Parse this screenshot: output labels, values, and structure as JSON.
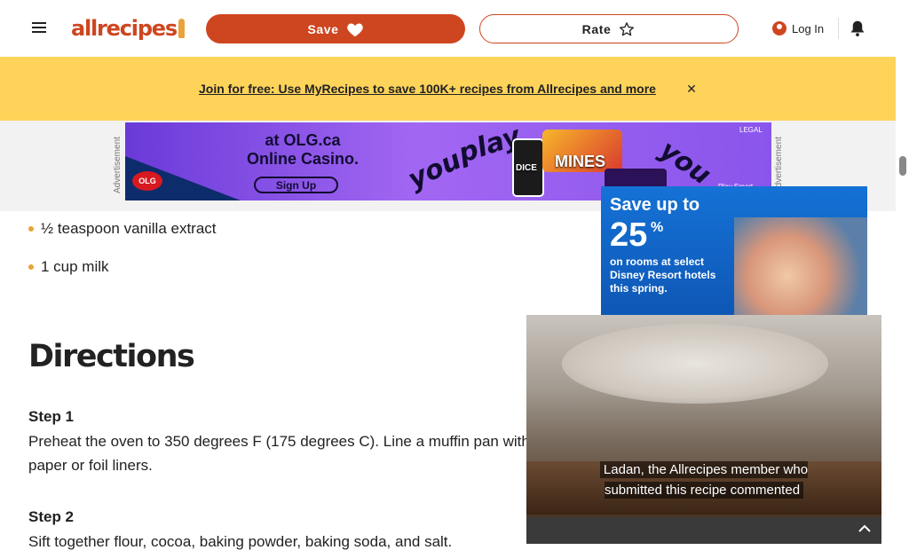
{
  "header": {
    "logo_text": "allrecipes",
    "save_label": "Save",
    "rate_label": "Rate",
    "login_label": "Log In"
  },
  "promo": {
    "link_text": "Join for free: Use MyRecipes to save 100K+ recipes from Allrecipes and more"
  },
  "ads": {
    "label": "Advertisement",
    "olg": {
      "headline_line1": "at OLG.ca",
      "headline_line2": "Online Casino.",
      "cta": "Sign Up",
      "word_left": "you",
      "word_mid": "play",
      "word_right": "you",
      "brand_1": "DICE",
      "brand_2": "MINES",
      "logo": "OLG",
      "legal": "LEGAL",
      "tagline": "Play Smart"
    },
    "disney": {
      "headline": "Save up to",
      "number": "25",
      "percent": "%",
      "subtext": "on rooms at select Disney Resort hotels this spring."
    }
  },
  "ingredients": [
    {
      "text": "½ teaspoon vanilla extract"
    },
    {
      "text": "1 cup milk"
    }
  ],
  "directions": {
    "title": "Directions",
    "steps": [
      {
        "label": "Step 1",
        "text": "Preheat the oven to 350 degrees F (175 degrees C). Line a muffin pan with paper or foil liners."
      },
      {
        "label": "Step 2",
        "text": "Sift together flour, cocoa, baking powder, baking soda, and salt."
      }
    ]
  },
  "video": {
    "caption": "Ladan, the Allrecipes member who submitted this recipe commented"
  },
  "colors": {
    "brand": "#ce4620",
    "promo_bg": "#fdd35a",
    "bullet": "#e8a33b"
  },
  "icons": {
    "menu": "hamburger-menu-icon",
    "save": "heart-icon",
    "rate": "star-icon",
    "user": "user-icon",
    "notifications": "bell-icon",
    "close": "close-icon",
    "collapse": "chevron-up-icon"
  }
}
